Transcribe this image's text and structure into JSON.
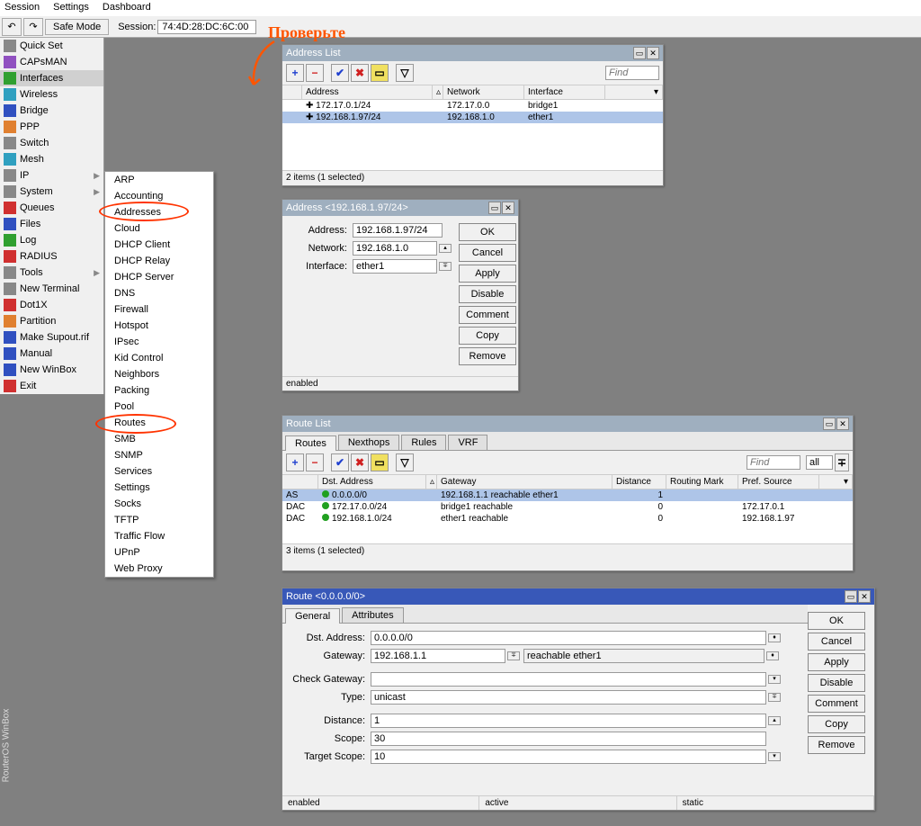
{
  "menu": {
    "session": "Session",
    "settings": "Settings",
    "dashboard": "Dashboard"
  },
  "topbar": {
    "safe_mode": "Safe Mode",
    "session_label": "Session:",
    "session_value": "74:4D:28:DC:6C:00"
  },
  "sidebar": [
    {
      "label": "Quick Set"
    },
    {
      "label": "CAPsMAN"
    },
    {
      "label": "Interfaces",
      "sel": true
    },
    {
      "label": "Wireless"
    },
    {
      "label": "Bridge"
    },
    {
      "label": "PPP"
    },
    {
      "label": "Switch"
    },
    {
      "label": "Mesh"
    },
    {
      "label": "IP",
      "arrow": true
    },
    {
      "label": "System",
      "arrow": true
    },
    {
      "label": "Queues"
    },
    {
      "label": "Files"
    },
    {
      "label": "Log"
    },
    {
      "label": "RADIUS"
    },
    {
      "label": "Tools",
      "arrow": true
    },
    {
      "label": "New Terminal"
    },
    {
      "label": "Dot1X"
    },
    {
      "label": "Partition"
    },
    {
      "label": "Make Supout.rif"
    },
    {
      "label": "Manual"
    },
    {
      "label": "New WinBox"
    },
    {
      "label": "Exit"
    }
  ],
  "ipmenu": [
    "ARP",
    "Accounting",
    "Addresses",
    "Cloud",
    "DHCP Client",
    "DHCP Relay",
    "DHCP Server",
    "DNS",
    "Firewall",
    "Hotspot",
    "IPsec",
    "Kid Control",
    "Neighbors",
    "Packing",
    "Pool",
    "Routes",
    "SMB",
    "SNMP",
    "Services",
    "Settings",
    "Socks",
    "TFTP",
    "Traffic Flow",
    "UPnP",
    "Web Proxy"
  ],
  "vertical_label": "RouterOS WinBox",
  "annotation": "Проверьте",
  "addr_list": {
    "title": "Address List",
    "cols": {
      "address": "Address",
      "network": "Network",
      "interface": "Interface"
    },
    "rows": [
      {
        "addr": "172.17.0.1/24",
        "net": "172.17.0.0",
        "if": "bridge1"
      },
      {
        "addr": "192.168.1.97/24",
        "net": "192.168.1.0",
        "if": "ether1",
        "sel": true
      }
    ],
    "status": "2 items (1 selected)",
    "find": "Find"
  },
  "addr_dlg": {
    "title": "Address <192.168.1.97/24>",
    "lbl_addr": "Address:",
    "val_addr": "192.168.1.97/24",
    "lbl_net": "Network:",
    "val_net": "192.168.1.0",
    "lbl_if": "Interface:",
    "val_if": "ether1",
    "btns": {
      "ok": "OK",
      "cancel": "Cancel",
      "apply": "Apply",
      "disable": "Disable",
      "comment": "Comment",
      "copy": "Copy",
      "remove": "Remove"
    },
    "status": "enabled"
  },
  "route_list": {
    "title": "Route List",
    "tabs": {
      "routes": "Routes",
      "nexthops": "Nexthops",
      "rules": "Rules",
      "vrf": "VRF"
    },
    "cols": {
      "dst": "Dst. Address",
      "gw": "Gateway",
      "dist": "Distance",
      "mark": "Routing Mark",
      "src": "Pref. Source"
    },
    "rows": [
      {
        "f": "AS",
        "dst": "0.0.0.0/0",
        "gw": "192.168.1.1 reachable ether1",
        "dist": "1",
        "mark": "",
        "src": "",
        "sel": true
      },
      {
        "f": "DAC",
        "dst": "172.17.0.0/24",
        "gw": "bridge1 reachable",
        "dist": "0",
        "mark": "",
        "src": "172.17.0.1"
      },
      {
        "f": "DAC",
        "dst": "192.168.1.0/24",
        "gw": "ether1 reachable",
        "dist": "0",
        "mark": "",
        "src": "192.168.1.97"
      }
    ],
    "status": "3 items (1 selected)",
    "find": "Find",
    "all": "all"
  },
  "route_dlg": {
    "title": "Route <0.0.0.0/0>",
    "tabs": {
      "general": "General",
      "attributes": "Attributes"
    },
    "lbl_dst": "Dst. Address:",
    "val_dst": "0.0.0.0/0",
    "lbl_gw": "Gateway:",
    "val_gw": "192.168.1.1",
    "gw_status": "reachable ether1",
    "lbl_check": "Check Gateway:",
    "val_check": "",
    "lbl_type": "Type:",
    "val_type": "unicast",
    "lbl_dist": "Distance:",
    "val_dist": "1",
    "lbl_scope": "Scope:",
    "val_scope": "30",
    "lbl_tscope": "Target Scope:",
    "val_tscope": "10",
    "btns": {
      "ok": "OK",
      "cancel": "Cancel",
      "apply": "Apply",
      "disable": "Disable",
      "comment": "Comment",
      "copy": "Copy",
      "remove": "Remove"
    },
    "status1": "enabled",
    "status2": "active",
    "status3": "static"
  }
}
